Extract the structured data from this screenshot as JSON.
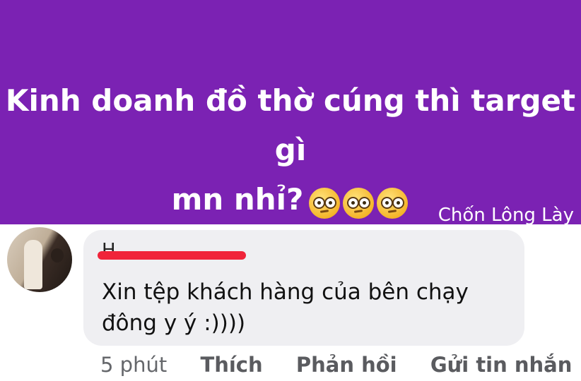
{
  "post": {
    "background": "#7b22b3",
    "line1": "Kinh doanh đồ thờ cúng thì target gì",
    "line2": "mn nhỉ?",
    "emojis": [
      "flushed-face-icon",
      "flushed-face-icon",
      "flushed-face-icon"
    ],
    "watermark": "Chốn Lông Lày"
  },
  "comment": {
    "author": "H",
    "text": "Xin tệp khách hàng của bên chạy đông y ý :))))",
    "time": "5 phút",
    "like_label": "Thích",
    "reply_label": "Phản hồi",
    "message_label": "Gửi tin nhắn"
  }
}
